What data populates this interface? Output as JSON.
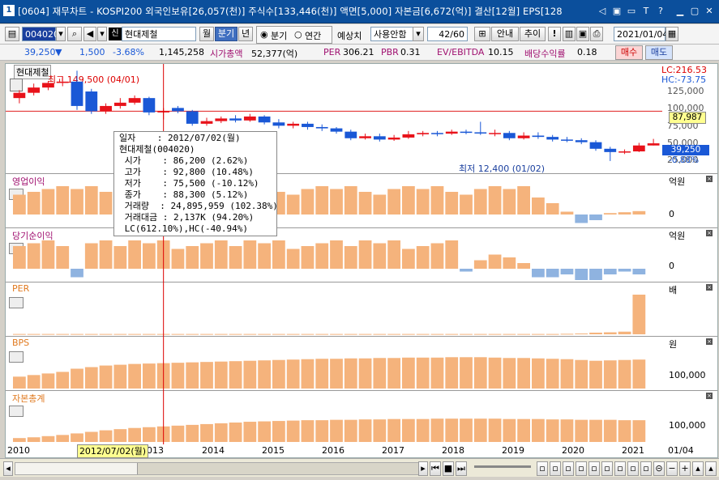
{
  "window": {
    "number": "1",
    "title": "[0604] 재무차트 - KOSPI200 외국인보유[26,057(천)] 주식수[133,446(천)] 액면[5,000] 자본금[6,672(억)] 결산[12월] EPS[128",
    "buttons": [
      "◁",
      "▣",
      "▭",
      "T",
      "?",
      "▁",
      "▢",
      "✕"
    ]
  },
  "toolbar": {
    "code": "004020",
    "market_tag": "신",
    "stock_name": "현대제철",
    "period_tabs": [
      "월",
      "분기",
      "년"
    ],
    "active_tab": "분기",
    "radio_quarter": "분기",
    "radio_annual": "연간",
    "forecast_label": "예상치",
    "forecast_select": "사용안함",
    "count": "42/60",
    "btn_guide": "안내",
    "btn_trend": "추이",
    "date": "2021/01/04"
  },
  "quote": {
    "price": "39,250",
    "change": "1,500",
    "change_pct": "-3.68%",
    "volume": "1,145,258",
    "mktcap_label": "시가총액",
    "mktcap": "52,377(억)",
    "per_label": "PER",
    "per": "306.21",
    "pbr_label": "PBR",
    "pbr": "0.31",
    "ev_label": "EV/EBITDA",
    "ev": "10.15",
    "div_label": "배당수익률",
    "div": "0.18",
    "buy": "매수",
    "sell": "매도"
  },
  "price_pane": {
    "name": "현대제철",
    "high_note": "최고 149,500 (04/01)",
    "low_note": "최저 12,400 (01/02)",
    "lc": "LC:216.53",
    "hc": "HC:-73.75",
    "ticks": [
      "125,000",
      "100,000",
      "75,000",
      "50,000",
      "25,000"
    ],
    "ref_price": "87,987",
    "cur_price": "39,250",
    "cur_pct": "-0.88%"
  },
  "panes": [
    {
      "title": "영업이익",
      "unit": "억원",
      "zero": "0"
    },
    {
      "title": "당기순이익",
      "unit": "억원",
      "zero": "0"
    },
    {
      "title": "PER",
      "unit": "배",
      "zero": ""
    },
    {
      "title": "BPS",
      "unit": "원",
      "zero": "100,000"
    },
    {
      "title": "자본총계",
      "unit": "",
      "zero": "100,000"
    }
  ],
  "xaxis": {
    "labels": [
      "2010",
      "013",
      "2014",
      "2015",
      "2016",
      "2017",
      "2018",
      "2019",
      "2020",
      "2021"
    ],
    "cursor_date": "2012/07/02(월)",
    "end_label": "01/04"
  },
  "tooltip": {
    "lines": [
      "일자    : 2012/07/02(월)",
      "현대제철(004020)",
      " 시가    : 86,200 (2.62%)",
      " 고가    : 92,800 (10.48%)",
      " 저가    : 75,500 (-10.12%)",
      " 종가    : 88,300 (5.12%)",
      " 거래량  : 24,895,959 (102.38%)",
      " 거래대금 : 2,137K (94.20%)",
      " LC(612.10%),HC(-40.94%)"
    ]
  },
  "colors": {
    "up": "#e8121a",
    "down": "#1a58d6",
    "bar": "#f5b37c",
    "neg": "#8fb3e0",
    "titlebar": "#0b4f9c",
    "label": "#a01070"
  },
  "chart_data": [
    {
      "type": "candlestick",
      "title": "현대제철",
      "x": [
        "2010Q1",
        "2010Q2",
        "2010Q3",
        "2010Q4",
        "2011Q1",
        "2011Q2",
        "2011Q3",
        "2011Q4",
        "2012Q1",
        "2012Q2",
        "2012Q3",
        "2012Q4",
        "2013Q1",
        "2013Q2",
        "2013Q3",
        "2013Q4",
        "2014Q1",
        "2014Q2",
        "2014Q3",
        "2014Q4",
        "2015Q1",
        "2015Q2",
        "2015Q3",
        "2015Q4",
        "2016Q1",
        "2016Q2",
        "2016Q3",
        "2016Q4",
        "2017Q1",
        "2017Q2",
        "2017Q3",
        "2017Q4",
        "2018Q1",
        "2018Q2",
        "2018Q3",
        "2018Q4",
        "2019Q1",
        "2019Q2",
        "2019Q3",
        "2019Q4",
        "2020Q1",
        "2020Q2",
        "2020Q3",
        "2020Q4",
        "2021Q1"
      ],
      "open": [
        108000,
        116000,
        124000,
        131000,
        133000,
        118000,
        88000,
        96000,
        101000,
        108000,
        86200,
        93000,
        88000,
        69000,
        73000,
        77000,
        74000,
        80000,
        71000,
        66000,
        69000,
        64000,
        62000,
        57000,
        47000,
        50000,
        45000,
        48000,
        53000,
        55000,
        54000,
        57000,
        56000,
        55000,
        55000,
        47000,
        51000,
        49000,
        45000,
        44000,
        41000,
        31000,
        26000,
        27000,
        36000
      ],
      "close": [
        116000,
        124000,
        131000,
        133000,
        96000,
        88000,
        96000,
        101000,
        108000,
        86200,
        88300,
        88000,
        69000,
        73000,
        77000,
        74000,
        80000,
        71000,
        66000,
        69000,
        64000,
        62000,
        57000,
        47000,
        50000,
        45000,
        48000,
        53000,
        55000,
        54000,
        57000,
        56000,
        55000,
        55000,
        47000,
        51000,
        49000,
        45000,
        44000,
        41000,
        31000,
        26000,
        27000,
        36000,
        39250
      ],
      "high": [
        120000,
        130000,
        134000,
        140000,
        149500,
        122000,
        100000,
        108000,
        112000,
        110000,
        92800,
        96000,
        90000,
        78000,
        80000,
        82000,
        84000,
        82000,
        76000,
        72000,
        72000,
        68000,
        64000,
        60000,
        54000,
        54000,
        52000,
        58000,
        58000,
        58000,
        60000,
        60000,
        72000,
        60000,
        58000,
        56000,
        56000,
        52000,
        49000,
        47000,
        44000,
        34000,
        30000,
        40000,
        46000
      ],
      "low": [
        100000,
        112000,
        120000,
        126000,
        90000,
        84000,
        84000,
        92000,
        98000,
        82000,
        75500,
        85000,
        66000,
        66000,
        70000,
        71000,
        72000,
        68000,
        62000,
        62000,
        60000,
        58000,
        54000,
        44000,
        45000,
        42000,
        43000,
        46000,
        50000,
        50000,
        52000,
        53000,
        52000,
        50000,
        44000,
        45000,
        46000,
        42000,
        41000,
        38000,
        28000,
        12400,
        23000,
        26000,
        36000
      ],
      "ylim": [
        0,
        150000
      ]
    },
    {
      "type": "bar",
      "title": "영업이익",
      "values": [
        7,
        8,
        9,
        10,
        9,
        10,
        8,
        7,
        9,
        10,
        9,
        10,
        8,
        7,
        9,
        10,
        9,
        10,
        8,
        7,
        9,
        10,
        9,
        10,
        8,
        7,
        9,
        10,
        9,
        10,
        8,
        7,
        9,
        10,
        9,
        10,
        6,
        4,
        1,
        -3,
        -2,
        0.5,
        0.8,
        1.2
      ]
    },
    {
      "type": "bar",
      "title": "당기순이익",
      "values": [
        8,
        9,
        10,
        8,
        -3,
        9,
        10,
        8,
        10,
        9,
        10,
        7,
        8,
        9,
        10,
        8,
        10,
        9,
        10,
        7,
        8,
        9,
        10,
        8,
        10,
        9,
        10,
        7,
        8,
        9,
        10,
        -1,
        3,
        5,
        4,
        2,
        -3,
        -3,
        -2,
        -4,
        -4,
        -2,
        -1,
        -2
      ]
    },
    {
      "type": "bar",
      "title": "PER",
      "values": [
        0.5,
        0.5,
        0.5,
        0.5,
        0.5,
        0.5,
        0.5,
        0.5,
        0.5,
        0.5,
        0.5,
        0.5,
        0.5,
        0.5,
        0.5,
        0.5,
        0.5,
        0.5,
        0.5,
        0.5,
        0.5,
        0.5,
        0.5,
        0.5,
        0.5,
        0.5,
        0.5,
        0.5,
        0.5,
        0.5,
        0.5,
        0.5,
        0.5,
        0.5,
        0.5,
        0.5,
        0.5,
        0.5,
        0.8,
        1.2,
        2.5,
        3,
        4,
        60
      ]
    },
    {
      "type": "bar",
      "title": "BPS",
      "values": [
        30,
        34,
        38,
        42,
        50,
        54,
        58,
        60,
        62,
        63,
        64,
        65,
        66,
        67,
        68,
        69,
        70,
        71,
        72,
        73,
        74,
        75,
        75,
        76,
        76,
        77,
        77,
        78,
        78,
        78,
        79,
        79,
        79,
        78,
        77,
        77,
        76,
        75,
        74,
        72,
        70,
        71,
        72,
        73
      ]
    },
    {
      "type": "bar",
      "title": "자본총계",
      "values": [
        10,
        12,
        15,
        18,
        22,
        26,
        30,
        33,
        36,
        38,
        40,
        42,
        44,
        46,
        48,
        50,
        52,
        53,
        54,
        55,
        56,
        56,
        57,
        57,
        58,
        58,
        59,
        59,
        59,
        60,
        60,
        60,
        60,
        60,
        59,
        59,
        59,
        58,
        58,
        57,
        57,
        57,
        56,
        56
      ]
    }
  ]
}
